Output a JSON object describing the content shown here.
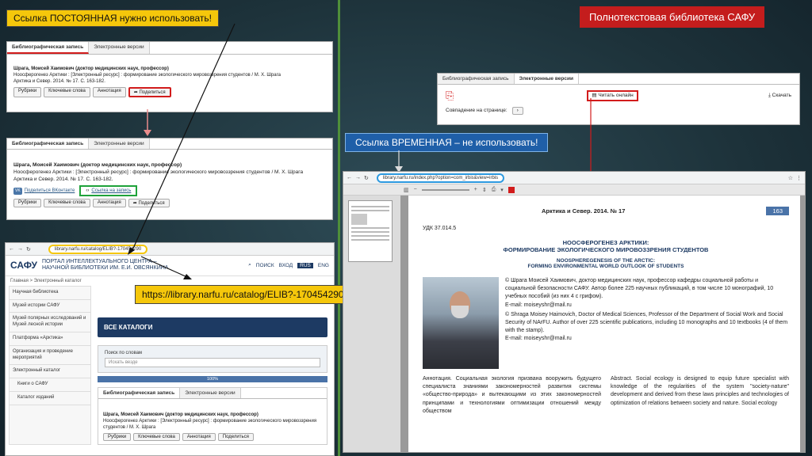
{
  "callouts": {
    "permanent": "Ссылка ПОСТОЯННАЯ нужно использовать!",
    "temporary": "Ссылка ВРЕМЕННАЯ – не использовать!",
    "library": "Полнотекстовая библиотека САФУ",
    "url": "https://library.narfu.ru/catalog/ELIB?-170454290"
  },
  "record": {
    "tab_bib": "Библиографическая запись",
    "tab_ev": "Электронные версии",
    "author_line": "Шрага, Моисей Хаимович (доктор медицинских наук, профессор)",
    "title_line": "Ноосферогенез Арктики : [Электронный ресурс] : формирование экологического мировоззрения студентов / М. Х. Шрага",
    "source_line": "Арктика и Север. 2014. № 17. С. 163-182.",
    "buttons": [
      "Рубрики",
      "Ключевые слова",
      "Аннотация",
      "Поделиться"
    ],
    "share_vk": "Поделиться ВКонтакте",
    "copy_link": "Ссылка на запись"
  },
  "ev_panel": {
    "read_online": "Читать онлайн",
    "download": "Скачать",
    "matches": "Совпадение на странице:"
  },
  "portal": {
    "address": "library.narfu.ru/catalog/ELIB?-170454290",
    "logo": "САФУ",
    "name_line1": "ПОРТАЛ ИНТЕЛЛЕКТУАЛЬНОГО ЦЕНТРА –",
    "name_line2": "НАУЧНОЙ БИБЛИОТЕКИ ИМ. Е.И. ОВСЯНКИНА",
    "search": "ПОИСК",
    "login": "ВХОД",
    "lang_ru": "RUS",
    "lang_en": "ENG",
    "breadcrumb": "Главная > Электронный каталог",
    "sidebar": [
      "Научная библиотека",
      "Музей истории САФУ",
      "Музей полярных исследований и Музей лесной истории",
      "Платформа «Арктика»",
      "Организация и проведение мероприятий",
      "Электронный каталог",
      "Книги о САФУ",
      "Каталог изданий"
    ],
    "catalog_header": "ВСЕ КАТАЛОГИ",
    "search_label": "Поиск по словам",
    "search_placeholder": "Искать везде",
    "results": "100%"
  },
  "pdf": {
    "address": "library.narfu.ru/index.php?option=com_irbis&view=irbis",
    "journal": "Арктика и Север. 2014. № 17",
    "page_no": "163",
    "udk": "УДК 37.014.5",
    "title_ru_1": "НООСФЕРОГЕНЕЗ АРКТИКИ:",
    "title_ru_2": "ФОРМИРОВАНИЕ ЭКОЛОГИЧЕСКОГО МИРОВОЗЗРЕНИЯ СТУДЕНТОВ",
    "title_en_1": "NOOSPHEREGENESIS OF THE ARCTIC:",
    "title_en_2": "FORMING ENVIRONMENTAL WORLD OUTLOOK OF STUDENTS",
    "bio_ru": "© Шрага Моисей Хаимович, доктор медицинских наук, профессор кафедры социальной работы и социальной безопасности САФУ. Автор более 225 научных публикаций, в том числе 10 монографий, 10 учебных пособий (из них 4 с грифом).",
    "email1": "E-mail: moiseyshr@mail.ru",
    "bio_en": "© Shraga Moisey Haimovich, Doctor of Medical Sciences, Professor of the Department of Social Work and Social Security of NArFU. Author of over 225 scientific publications, including 10 monographs and 10 textbooks (4 of them with the stamp).",
    "email2": "E-mail: moiseyshr@mail.ru",
    "annot_ru": "Аннотация. Социальная экология призвана вооружить будущего специалиста знаниями закономерностей развития системы «общество-природа» и вытекающими из этих закономерностей принципами и технологиями оптимизации отношений между обществом",
    "annot_en": "Abstract. Social ecology is designed to equip future specialist with knowledge of the regularities of the system \"society-nature\" development and derived from these laws principles and technologies of optimization of relations between society and nature. Social ecology"
  }
}
